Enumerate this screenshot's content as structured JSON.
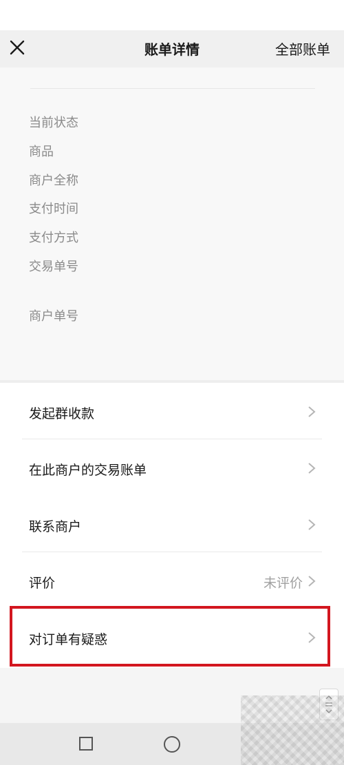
{
  "header": {
    "title": "账单详情",
    "right_link": "全部账单",
    "close_icon": "close-icon"
  },
  "details": {
    "labels": [
      "当前状态",
      "商品",
      "商户全称",
      "支付时间",
      "支付方式",
      "交易单号",
      "商户单号"
    ]
  },
  "actions": [
    {
      "label": "发起群收款",
      "value": ""
    },
    {
      "label": "在此商户的交易账单",
      "value": ""
    },
    {
      "label": "联系商户",
      "value": ""
    },
    {
      "label": "评价",
      "value": "未评价"
    },
    {
      "label": "对订单有疑惑",
      "value": ""
    }
  ],
  "colors": {
    "highlight_border": "#d3161f",
    "label_gray": "#8a8a8a",
    "text_dark": "#1a1a1a"
  }
}
